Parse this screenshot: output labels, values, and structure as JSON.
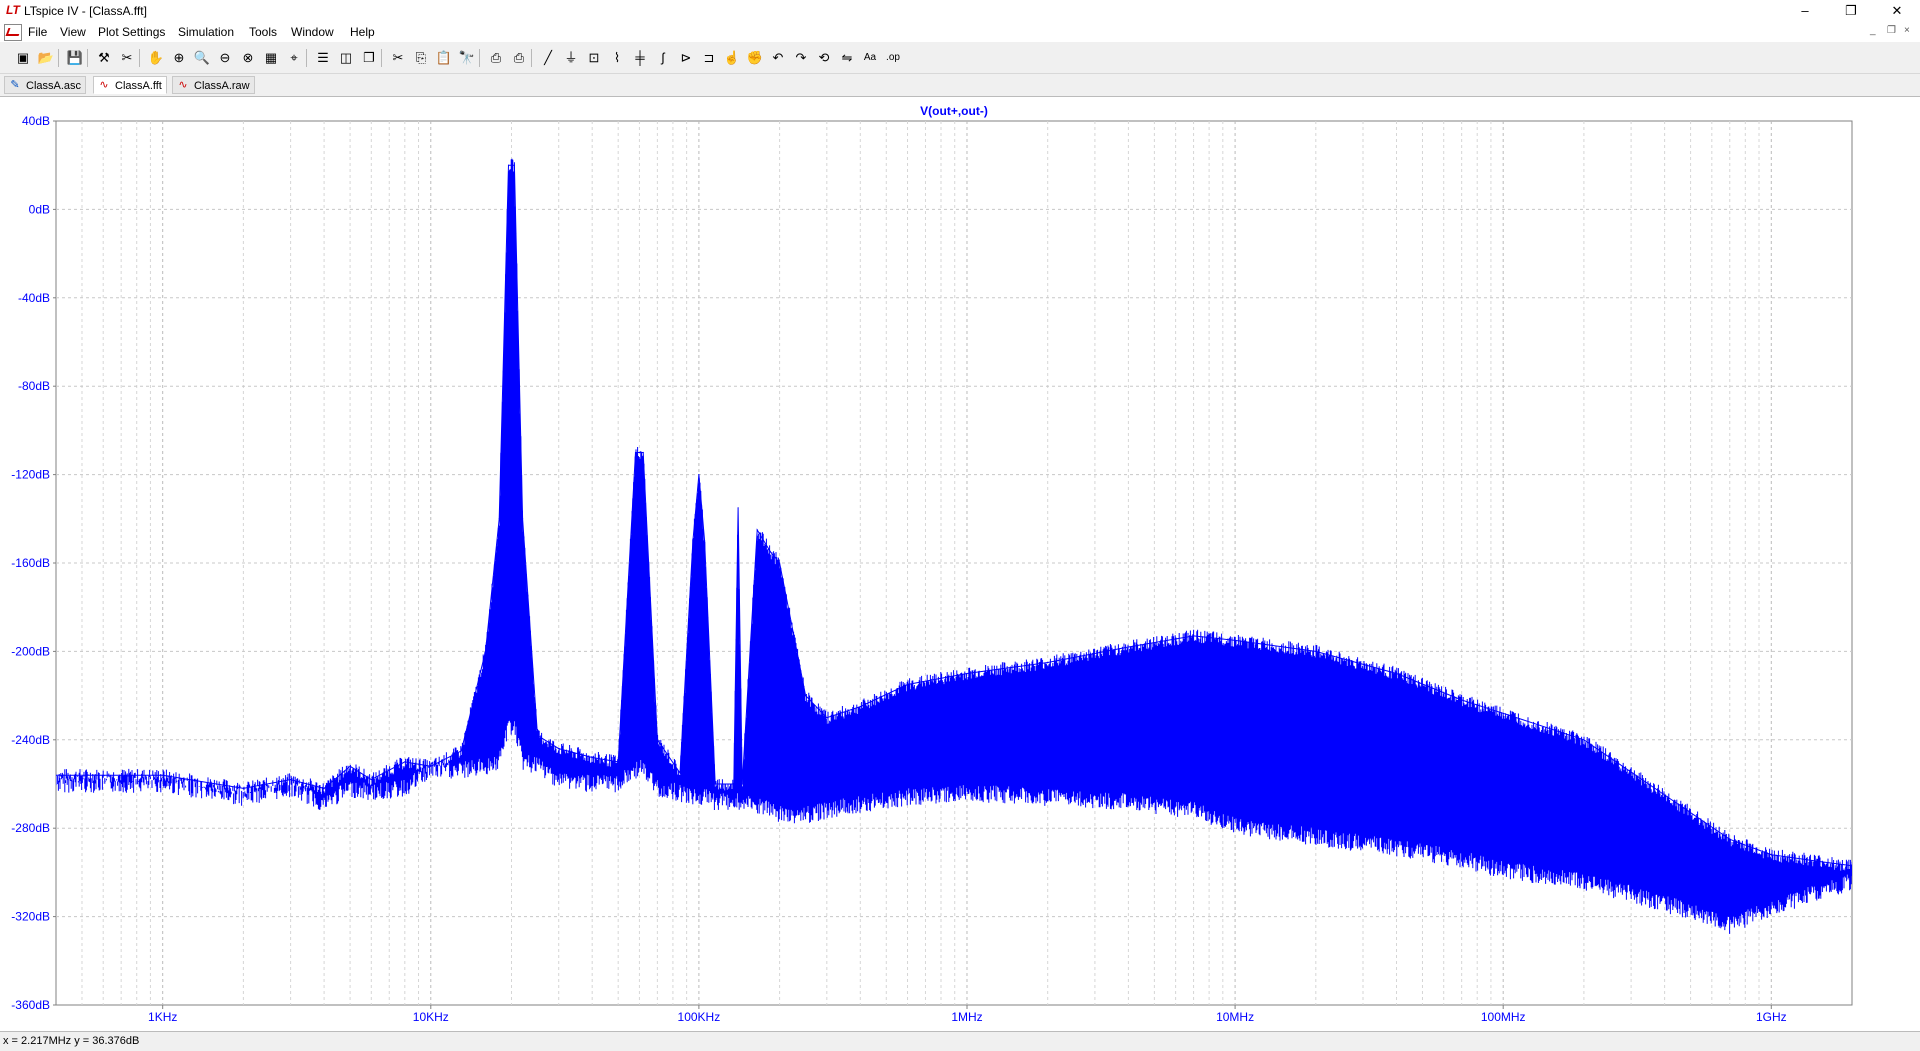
{
  "window": {
    "title": "LTspice IV - [ClassA.fft]",
    "app_logo_text": "LT",
    "controls": [
      "–",
      "❐",
      "✕"
    ],
    "mdi_controls": [
      "_",
      "❐",
      "×"
    ]
  },
  "menu": {
    "items": [
      "File",
      "View",
      "Plot Settings",
      "Simulation",
      "Tools",
      "Window",
      "Help"
    ]
  },
  "toolbar": {
    "icons": [
      "new-schematic-icon",
      "open-icon",
      "save-icon",
      "control-panel-icon",
      "autorange-icon",
      "pan-icon",
      "zoom-in-icon",
      "zoom-area-icon",
      "zoom-out-icon",
      "zoom-fit-icon",
      "grid-icon",
      "cursor-icon",
      "tile-horizontal-icon",
      "tile-vertical-icon",
      "cascade-icon",
      "cut-icon",
      "copy-icon",
      "paste-icon",
      "find-icon",
      "print-icon",
      "print-preview-icon",
      "wire-icon",
      "ground-icon",
      "label-icon",
      "resistor-icon",
      "capacitor-icon",
      "inductor-icon",
      "diode-icon",
      "component-icon",
      "move-icon",
      "drag-icon",
      "undo-icon",
      "redo-icon",
      "rotate-icon",
      "mirror-icon",
      "text-icon",
      "spice-directive-icon"
    ]
  },
  "tabs": [
    {
      "label": "ClassA.asc",
      "icon": "schematic-icon",
      "active": false
    },
    {
      "label": "ClassA.fft",
      "icon": "waveform-icon",
      "active": true
    },
    {
      "label": "ClassA.raw",
      "icon": "waveform-icon",
      "active": false
    }
  ],
  "colors": {
    "trace": "#0000ff",
    "grid": "#c8c8c8",
    "axis_text": "#0000ff"
  },
  "chart_data": {
    "type": "line",
    "title": "V(out+,out-)",
    "xlabel": "",
    "ylabel": "",
    "x_scale": "log",
    "xlim": [
      400,
      2000000000
    ],
    "ylim": [
      -360,
      40
    ],
    "grid": true,
    "ytick_labels": [
      "40dB",
      "0dB",
      "-40dB",
      "-80dB",
      "-120dB",
      "-160dB",
      "-200dB",
      "-240dB",
      "-280dB",
      "-320dB",
      "-360dB"
    ],
    "ytick_values": [
      40,
      0,
      -40,
      -80,
      -120,
      -160,
      -200,
      -240,
      -280,
      -320,
      -360
    ],
    "xtick_labels": [
      "1KHz",
      "10KHz",
      "100KHz",
      "1MHz",
      "10MHz",
      "100MHz",
      "1GHz"
    ],
    "xtick_values": [
      1000,
      10000,
      100000,
      1000000,
      10000000,
      100000000,
      1000000000
    ],
    "series": [
      {
        "color": "#0000ff",
        "x": [
          400,
          1000,
          2000,
          3000,
          4000,
          5000,
          6000,
          8000,
          10000,
          13000,
          16000,
          18000,
          19500,
          20000,
          20500,
          22000,
          25000,
          30000,
          40000,
          50000,
          58000,
          60000,
          62000,
          70000,
          85000,
          95000,
          100000,
          105000,
          115000,
          135000,
          140000,
          145000,
          165000,
          185000,
          200000,
          250000,
          300000,
          400000,
          600000,
          1000000,
          2000000,
          4000000,
          7000000,
          10000000,
          20000000,
          40000000,
          70000000,
          100000000,
          200000000,
          400000000,
          700000000,
          1000000000,
          1500000000,
          2000000000
        ],
        "y": [
          -256,
          -256,
          -262,
          -258,
          -262,
          -252,
          -258,
          -250,
          -252,
          -245,
          -200,
          -140,
          20,
          20,
          20,
          -140,
          -238,
          -244,
          -248,
          -250,
          -110,
          -110,
          -110,
          -240,
          -255,
          -150,
          -120,
          -150,
          -260,
          -260,
          -135,
          -260,
          -145,
          -155,
          -160,
          -220,
          -230,
          -225,
          -215,
          -210,
          -205,
          -198,
          -193,
          -195,
          -200,
          -210,
          -222,
          -228,
          -240,
          -265,
          -285,
          -292,
          -295,
          -297
        ],
        "y_lower": [
          -256,
          -256,
          -262,
          -258,
          -265,
          -258,
          -260,
          -258,
          -250,
          -250,
          -248,
          -246,
          -230,
          -230,
          -230,
          -246,
          -248,
          -254,
          -256,
          -256,
          -250,
          -248,
          -250,
          -258,
          -260,
          -262,
          -262,
          -262,
          -264,
          -264,
          -264,
          -265,
          -266,
          -268,
          -270,
          -270,
          -268,
          -265,
          -262,
          -260,
          -262,
          -264,
          -268,
          -275,
          -280,
          -285,
          -290,
          -295,
          -300,
          -310,
          -320,
          -312,
          -305,
          -300
        ]
      }
    ]
  },
  "status": {
    "cursor_readout": "x = 2.217MHz   y = 36.376dB"
  }
}
